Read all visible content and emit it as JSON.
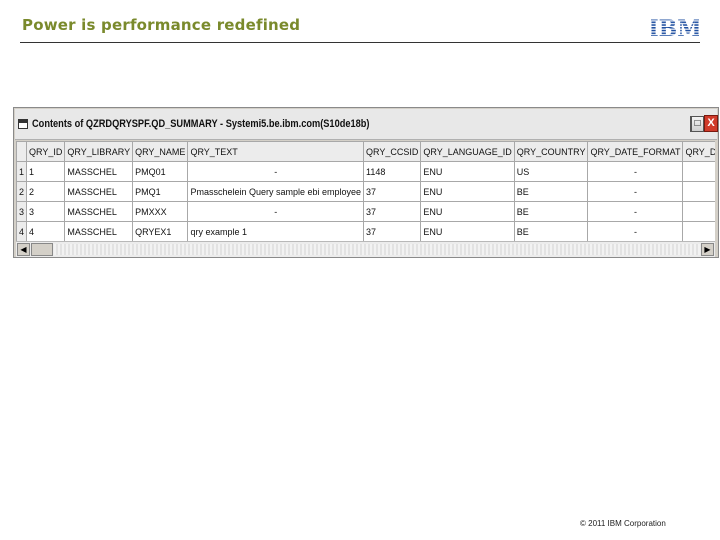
{
  "slide": {
    "title": "Power is performance redefined",
    "logo_text": "IBM",
    "footer": "© 2011 IBM Corporation"
  },
  "window": {
    "title": "Contents of QZRDQRYSPF.QD_SUMMARY - Systemi5.be.ibm.com(S10de18b)",
    "min_label": "_",
    "max_label": "□",
    "close_label": "X"
  },
  "table": {
    "columns": [
      "QRY_ID",
      "QRY_LIBRARY",
      "QRY_NAME",
      "QRY_TEXT",
      "QRY_CCSID",
      "QRY_LANGUAGE_ID",
      "QRY_COUNTRY",
      "QRY_DATE_FORMAT",
      "QRY_DATE_SEPARATOR"
    ],
    "rows": [
      {
        "num": "1",
        "cells": [
          "1",
          "MASSCHEL",
          "PMQ01",
          "-",
          "1148",
          "ENU",
          "US",
          "-",
          "-"
        ]
      },
      {
        "num": "2",
        "cells": [
          "2",
          "MASSCHEL",
          "PMQ1",
          "Pmasschelein Query sample ebi employee",
          "37",
          "ENU",
          "BE",
          "-",
          "-"
        ]
      },
      {
        "num": "3",
        "cells": [
          "3",
          "MASSCHEL",
          "PMXXX",
          "-",
          "37",
          "ENU",
          "BE",
          "-",
          "-"
        ]
      },
      {
        "num": "4",
        "cells": [
          "4",
          "MASSCHEL",
          "QRYEX1",
          "qry example 1",
          "37",
          "ENU",
          "BE",
          "-",
          "-"
        ]
      }
    ]
  },
  "colors": {
    "title_color": "#7a8a2c",
    "logo_color": "#1f4fa0",
    "close_button": "#d03a2a"
  }
}
